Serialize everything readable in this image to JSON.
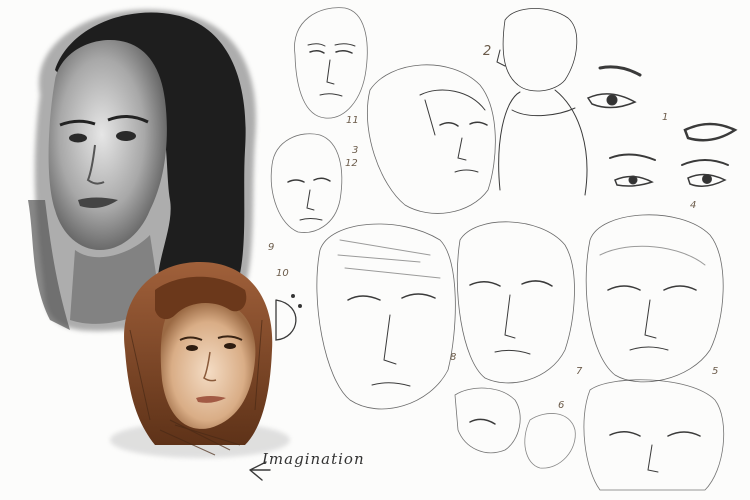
{
  "image": {
    "subject": "portrait-sketch-sheet",
    "colors": {
      "paper": "#fcfcfb",
      "ink": "#3a3a3a",
      "grey_paint_dark": "#1e1e1e",
      "brown_hair": "#7a4526",
      "skin_warm": "#e8c4a4"
    }
  },
  "annotations": {
    "caption": "Imagination",
    "numbers": [
      "11",
      "2",
      "1",
      "12",
      "3",
      "9",
      "10",
      "4",
      "8",
      "7",
      "5",
      "6"
    ]
  }
}
